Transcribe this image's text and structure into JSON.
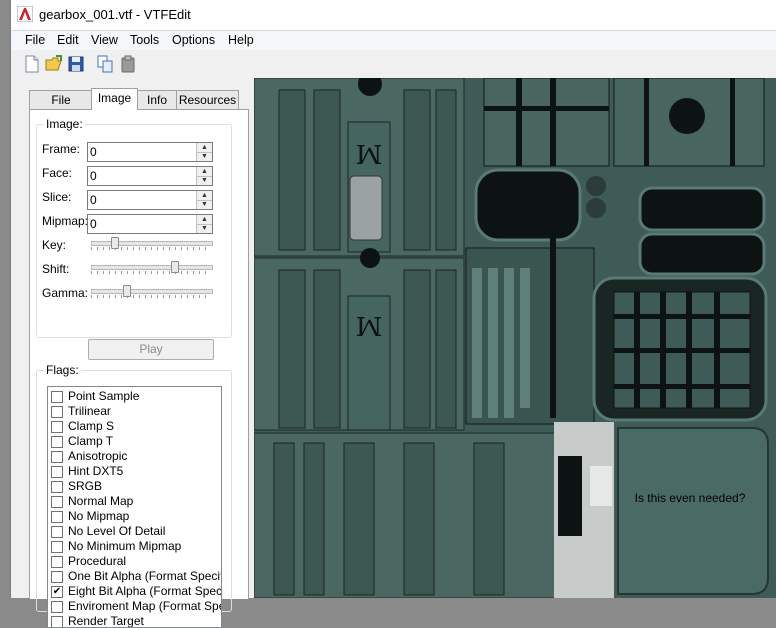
{
  "window": {
    "title": "gearbox_001.vtf - VTFEdit"
  },
  "menu": {
    "items": [
      "File",
      "Edit",
      "View",
      "Tools",
      "Options",
      "Help"
    ]
  },
  "toolbar": {
    "buttons": [
      "new-file-icon",
      "open-folder-icon",
      "save-icon",
      "copy-icon",
      "paste-icon"
    ]
  },
  "tabs": [
    "File System",
    "Image",
    "Info",
    "Resources"
  ],
  "image_group": {
    "title": "Image:",
    "frame_label": "Frame:",
    "frame_value": "0",
    "face_label": "Face:",
    "face_value": "0",
    "slice_label": "Slice:",
    "slice_value": "0",
    "mipmap_label": "Mipmap:",
    "mipmap_value": "0",
    "key_label": "Key:",
    "shift_label": "Shift:",
    "gamma_label": "Gamma:",
    "play_label": "Play"
  },
  "flags_group": {
    "title": "Flags:",
    "items": [
      {
        "label": "Point Sample",
        "checked": false
      },
      {
        "label": "Trilinear",
        "checked": false
      },
      {
        "label": "Clamp S",
        "checked": false
      },
      {
        "label": "Clamp T",
        "checked": false
      },
      {
        "label": "Anisotropic",
        "checked": false
      },
      {
        "label": "Hint DXT5",
        "checked": false
      },
      {
        "label": "SRGB",
        "checked": false
      },
      {
        "label": "Normal Map",
        "checked": false
      },
      {
        "label": "No Mipmap",
        "checked": false
      },
      {
        "label": "No Level Of Detail",
        "checked": false
      },
      {
        "label": "No Minimum Mipmap",
        "checked": false
      },
      {
        "label": "Procedural",
        "checked": false
      },
      {
        "label": "One Bit Alpha (Format Specifi",
        "checked": false
      },
      {
        "label": "Eight Bit Alpha (Format Specif",
        "checked": true
      },
      {
        "label": "Enviroment Map (Format Spe",
        "checked": false
      },
      {
        "label": "Render Target",
        "checked": false
      }
    ]
  },
  "texture": {
    "annotation": "Is this even needed?",
    "stamp_glyph": "ꟽ",
    "colors": {
      "base": "#3f5b57",
      "dark": "#0d1312",
      "panel": "#4a6a65"
    }
  }
}
